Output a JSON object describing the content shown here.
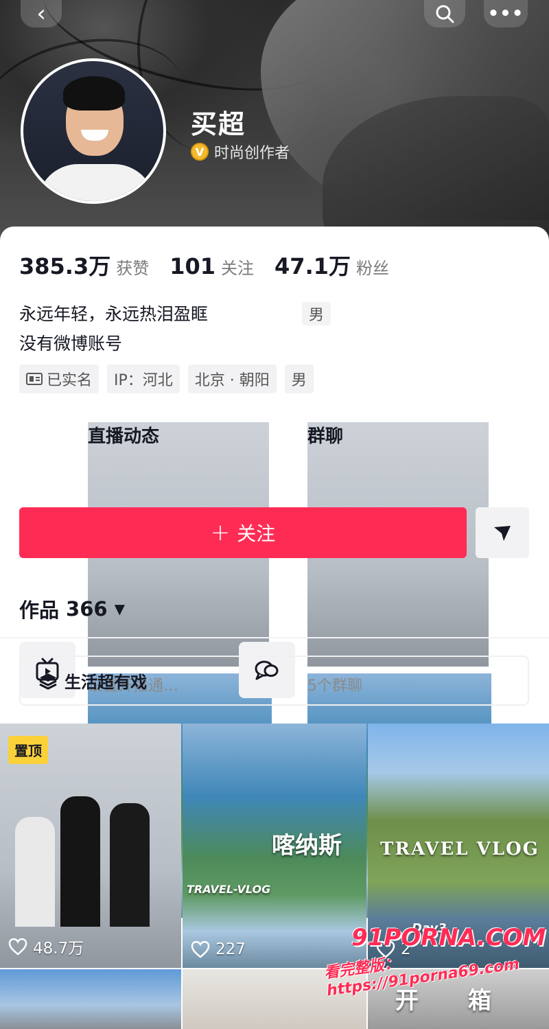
{
  "header": {
    "name": "买超",
    "creator_badge": "时尚创作者"
  },
  "stats": [
    {
      "num": "385.3万",
      "label": "获赞"
    },
    {
      "num": "101",
      "label": "关注"
    },
    {
      "num": "47.1万",
      "label": "粉丝"
    }
  ],
  "bio": {
    "line1": "永远年轻，永远热泪盈眶",
    "line2": "没有微博账号",
    "gender_note": "男"
  },
  "tags": {
    "verified": "已实名",
    "ip": "IP：河北",
    "location": "北京 · 朝阳",
    "gender": "男"
  },
  "shortcuts": {
    "live": {
      "title": "直播动态",
      "subtitle": "设置开播通…"
    },
    "group": {
      "title": "群聊",
      "subtitle": "5个群聊"
    }
  },
  "follow_button": "关注",
  "works": {
    "label": "作品",
    "count": "366"
  },
  "collection": "生活超有戏",
  "videos": [
    {
      "likes": "48.7万",
      "badge": "置顶"
    },
    {
      "likes": "227",
      "overlay": "喀纳斯",
      "overlay2": "TRAVEL-VLOG"
    },
    {
      "likes": "2",
      "overlay": "TRAVEL VLOG",
      "overlay2": "Day3"
    },
    {
      "overlay": "开 箱"
    }
  ],
  "watermark": {
    "line1": "91PORNA.COM",
    "line2": "看完整版：https://91porna69.com"
  },
  "colors": {
    "accent": "#fe2c55",
    "badge": "#f4b92d",
    "pinned": "#fbd13a"
  }
}
